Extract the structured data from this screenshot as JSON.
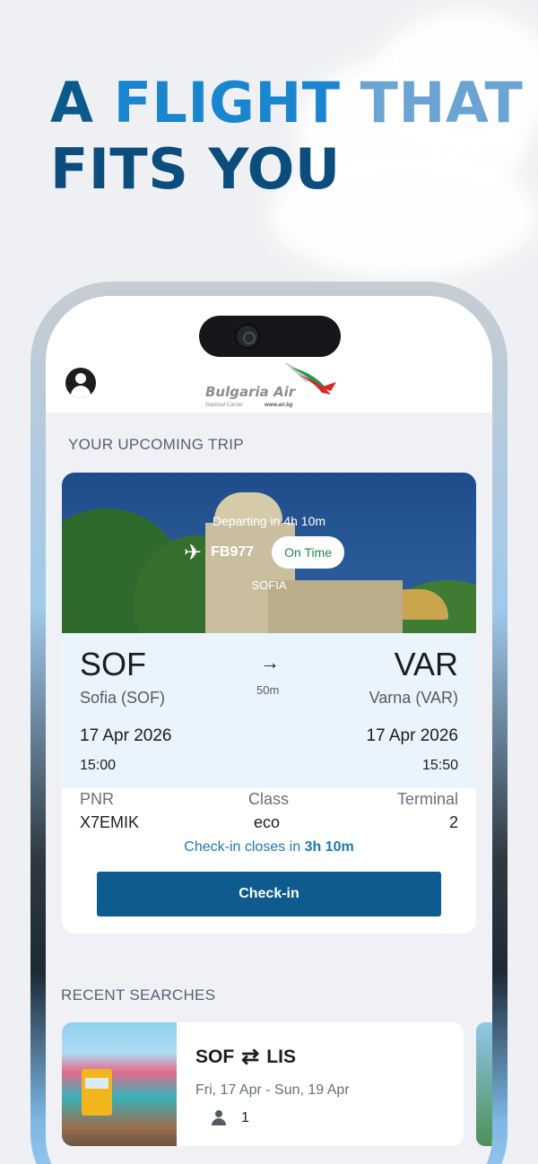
{
  "headline": {
    "line1_part1": "A ",
    "line1_part2": "FLIGHT ",
    "line1_part3": "THAT",
    "line2": "FITS YOU"
  },
  "app": {
    "logo_text": "Bulgaria Air",
    "logo_tagline": "National Carrier",
    "logo_url_text": "www.air.bg"
  },
  "upcoming": {
    "section_title": "YOUR UPCOMING TRIP",
    "departing_text": "Departing in 4h 10m",
    "flight_number": "FB977",
    "status": "On Time",
    "city_banner": "SOFIA",
    "origin_code": "SOF",
    "origin_city": "Sofia (SOF)",
    "destination_code": "VAR",
    "destination_city": "Varna (VAR)",
    "arrow": "→",
    "duration": "50m",
    "departure_date": "17 Apr 2026",
    "departure_time": "15:00",
    "arrival_date": "17 Apr 2026",
    "arrival_time": "15:50",
    "pnr_label": "PNR",
    "pnr_value": "X7EMIK",
    "class_label": "Class",
    "class_value": "eco",
    "terminal_label": "Terminal",
    "terminal_value": "2",
    "checkin_note_prefix": "Check-in closes in ",
    "checkin_note_time": "3h 10m",
    "checkin_button": "Check-in"
  },
  "recent": {
    "section_title": "RECENT SEARCHES",
    "items": [
      {
        "from": "SOF",
        "to": "LIS",
        "swap_glyph": "⇄",
        "dates": "Fri, 17 Apr - Sun, 19 Apr",
        "passengers": "1"
      }
    ]
  },
  "icons": {
    "plane": "plane-icon",
    "profile": "profile-icon",
    "swap": "swap-icon",
    "passenger": "person-icon"
  },
  "colors": {
    "primary": "#0d5b8f",
    "accent": "#1d78b5",
    "status_green": "#1e8a47",
    "headline_dark": "#0b4d7c",
    "headline_light": "#1a86cf"
  }
}
